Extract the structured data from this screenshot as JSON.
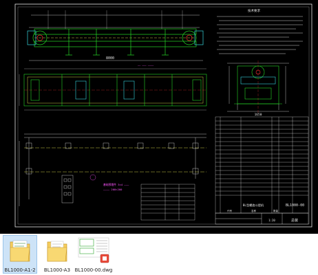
{
  "viewer": {
    "background": "#000000",
    "line_colors": {
      "green": "#26d926",
      "yellow": "#ffff55",
      "white": "#e8e8e8",
      "red": "#ff3333",
      "cyan": "#37d7e0",
      "magenta": "#ff55ff"
    }
  },
  "drawing": {
    "notes_title": "技术要求",
    "dim_total_length": "8000",
    "cross_section_width": "1650",
    "scale_text": "1:20",
    "title_block_code": "BL1000-00",
    "title_block_name": "BL型螺旋斗提机",
    "title_block_org": "总装",
    "parts_header_code": "代号",
    "parts_header_name": "名称",
    "parts_header_qty": "数量"
  },
  "files": [
    {
      "name": "BL1000-A1-2",
      "icon": "folder-icon",
      "selected": true
    },
    {
      "name": "BL1000-A3",
      "icon": "folder-icon",
      "selected": false
    },
    {
      "name": "BL1000-00.dwg",
      "icon": "dwg-file-icon",
      "selected": false
    }
  ]
}
